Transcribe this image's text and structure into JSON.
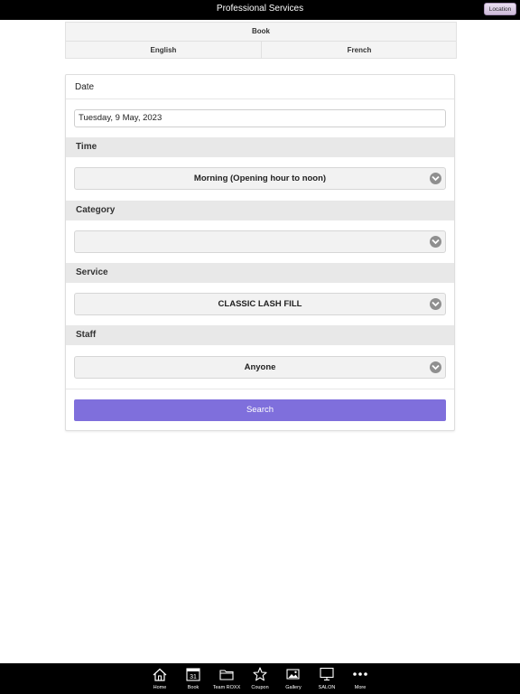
{
  "header": {
    "title": "Professional Services",
    "location_button": "Location"
  },
  "book_tabs": {
    "title": "Book",
    "languages": [
      "English",
      "French"
    ]
  },
  "form": {
    "date": {
      "label": "Date",
      "value": "Tuesday, 9 May, 2023"
    },
    "time": {
      "label": "Time",
      "selected": "Morning (Opening hour to noon)"
    },
    "category": {
      "label": "Category",
      "selected": ""
    },
    "service": {
      "label": "Service",
      "selected": "CLASSIC LASH FILL"
    },
    "staff": {
      "label": "Staff",
      "selected": "Anyone"
    },
    "search_button": "Search"
  },
  "bottom_nav": {
    "items": [
      {
        "label": "Home",
        "icon": "home-icon"
      },
      {
        "label": "Book",
        "icon": "calendar-icon",
        "badge": "31"
      },
      {
        "label": "Team ROXX",
        "icon": "folder-icon"
      },
      {
        "label": "Coupon",
        "icon": "star-icon"
      },
      {
        "label": "Gallery",
        "icon": "gallery-icon"
      },
      {
        "label": "SALON",
        "icon": "monitor-icon"
      },
      {
        "label": "More",
        "icon": "more-icon"
      }
    ]
  },
  "colors": {
    "accent": "#7f6fdc",
    "bars": "#000000",
    "section_bg": "#e8e8e8"
  }
}
